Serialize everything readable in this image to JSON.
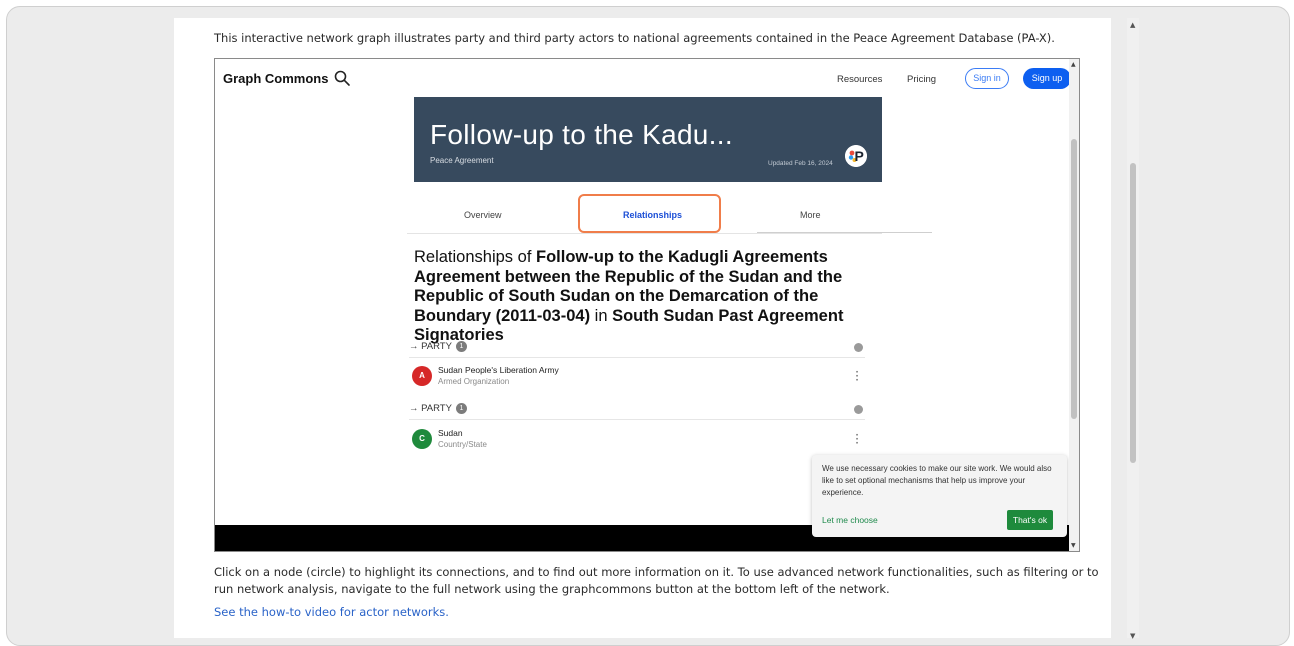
{
  "page": {
    "intro_text": "This interactive network graph illustrates party and third party actors to national agreements contained in the Peace Agreement Database (PA-X).",
    "footer_text": "Click on a node (circle) to highlight its connections, and to find out more information on it. To use advanced network functionalities, such as filtering or to run network analysis, navigate to the full network using the graphcommons button at the bottom left of the network.",
    "footer_link": "See the how-to video for actor networks."
  },
  "embed": {
    "brand": "Graph Commons",
    "nav": {
      "resources": "Resources",
      "pricing": "Pricing",
      "sign_in": "Sign in",
      "sign_up": "Sign up"
    },
    "hero": {
      "title": "Follow-up to the Kadu...",
      "subtitle": "Peace Agreement",
      "updated": "Updated Feb 16, 2024",
      "bg_color": "#374a5e"
    },
    "tabs": [
      {
        "label": "Overview"
      },
      {
        "label": "Relationships"
      },
      {
        "label": "More"
      }
    ],
    "relationships_heading": {
      "prefix": "Relationships of ",
      "node": "Follow-up to the Kadugli Agreements Agreement between the Republic of the Sudan and the Republic of South Sudan on the Demarcation of the Boundary (2011-03-04)",
      "middle": " in ",
      "graph": "South Sudan Past Agreement Signatories"
    },
    "sections": [
      {
        "title": "→ PARTY",
        "count": "1",
        "item": {
          "avatar": "A",
          "name": "Sudan People's Liberation Army",
          "type": "Armed Organization",
          "color": "#d62828"
        }
      },
      {
        "title": "→ PARTY",
        "count": "1",
        "item": {
          "avatar": "C",
          "name": "Sudan",
          "type": "Country/State",
          "color": "#1f8a3c"
        }
      }
    ],
    "cookie": {
      "text": "We use necessary cookies to make our site work. We would also like to set optional mechanisms that help us improve your experience.",
      "choose": "Let me choose",
      "ok": "That's ok"
    },
    "accent_color": "#0d5ff0",
    "highlight_color": "#f07d4a"
  }
}
